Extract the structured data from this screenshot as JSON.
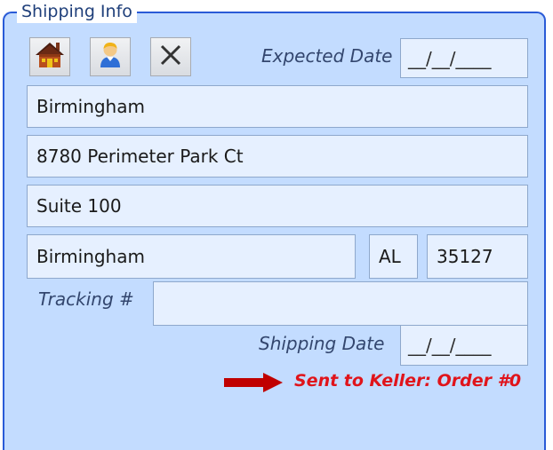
{
  "group": {
    "title": "Shipping Info"
  },
  "toolbar": {
    "buttons": [
      {
        "icon": "house-icon"
      },
      {
        "icon": "person-icon"
      },
      {
        "icon": "close-icon"
      }
    ]
  },
  "expected_date": {
    "label": "Expected Date",
    "value": "__/__/____"
  },
  "address": {
    "line1": "Birmingham",
    "line2": "8780 Perimeter Park Ct",
    "line3": "Suite 100",
    "city": "Birmingham",
    "state": "AL",
    "zip": "35127"
  },
  "tracking": {
    "label": "Tracking #",
    "value": ""
  },
  "shipping_date": {
    "label": "Shipping Date",
    "value": "__/__/____"
  },
  "status": {
    "text": "Sent to Keller: Order #0",
    "color": "#e0141b"
  },
  "colors": {
    "panel_bg": "#c3dcff",
    "panel_border": "#2a5bd7",
    "field_bg": "#e6f0ff",
    "arrow": "#c00000"
  }
}
